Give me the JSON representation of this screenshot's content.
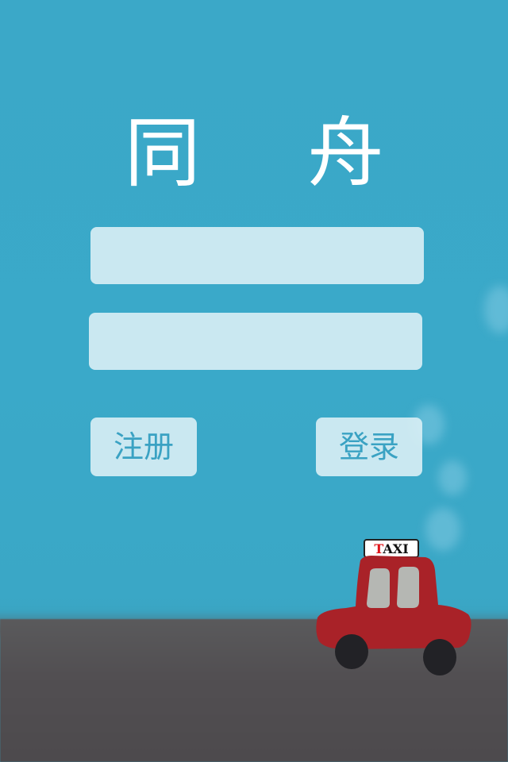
{
  "app": {
    "title": "同 舟"
  },
  "login_form": {
    "username_value": "",
    "password_value": "",
    "register_label": "注册",
    "login_label": "登录"
  },
  "illustration": {
    "taxi_sign_first_letter": "T",
    "taxi_sign_rest": "AXI",
    "car_color": "#a92228",
    "sign_first_letter_color": "#e0141a"
  },
  "colors": {
    "background": "#3aa8c8",
    "ground": "#524f52",
    "field_fill": "#d7eef4",
    "button_text": "#3aa2c3",
    "title_text": "#ffffff"
  }
}
